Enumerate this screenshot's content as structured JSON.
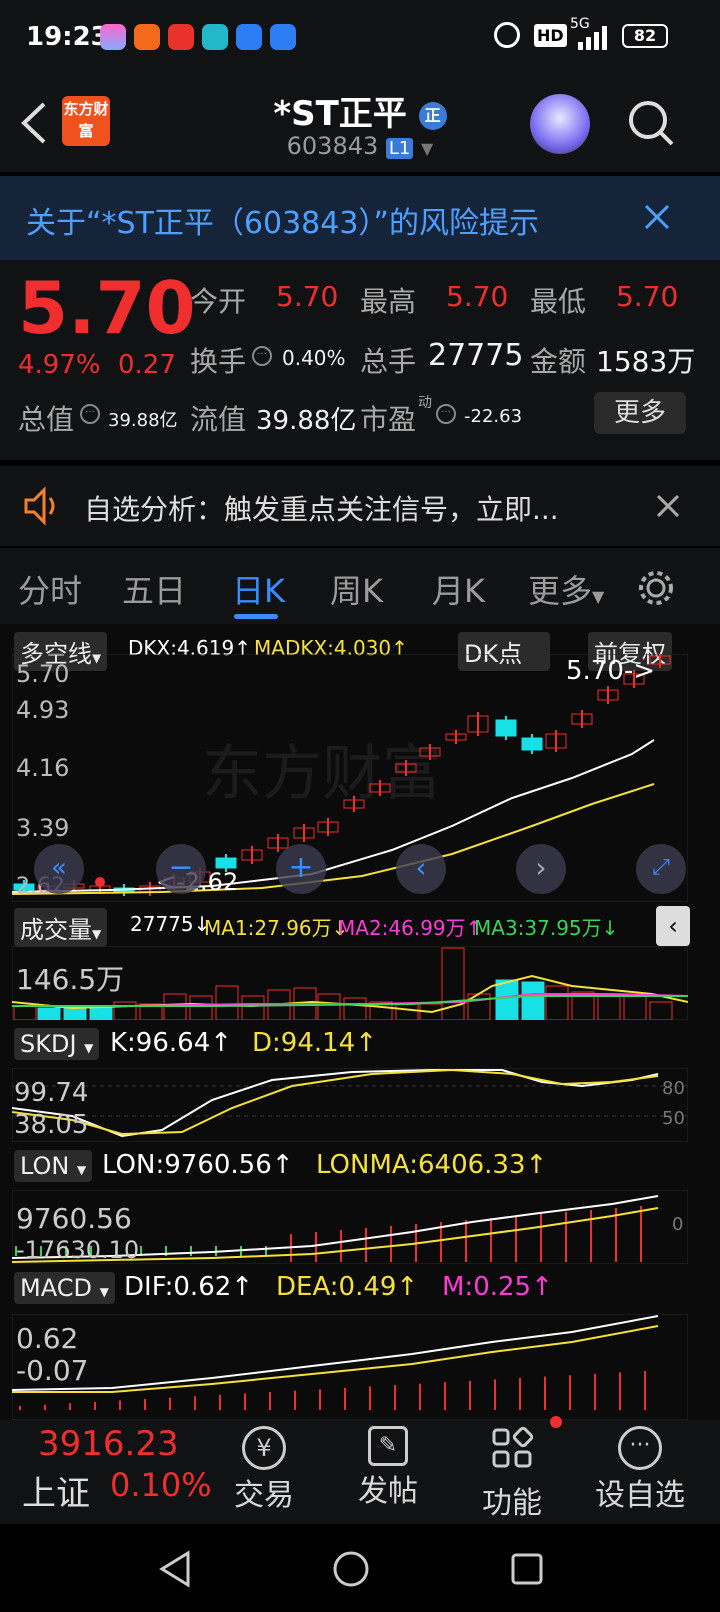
{
  "status_bar": {
    "time": "19:23",
    "network": "5G",
    "battery": "82",
    "hd": "HD"
  },
  "header": {
    "title": "*ST正平",
    "badge": "正",
    "code": "603843",
    "level": "L1",
    "logo_text": "东方财富"
  },
  "banner": {
    "text": "关于“*ST正平（603843）”的风险提示"
  },
  "quote": {
    "price": "5.70",
    "change_pct": "4.97%",
    "change": "0.27",
    "open_label": "今开",
    "open": "5.70",
    "high_label": "最高",
    "high": "5.70",
    "low_label": "最低",
    "low": "5.70",
    "turnover_label": "换手",
    "turnover": "0.40%",
    "volume_label": "总手",
    "volume": "27775",
    "amount_label": "金额",
    "amount": "1583万",
    "mcap_label": "总值",
    "mcap": "39.88亿",
    "float_label": "流值",
    "float": "39.88亿",
    "pe_label": "市盈",
    "pe_sup": "动",
    "pe": "-22.63",
    "more_button": "更多"
  },
  "notice": {
    "text": "自选分析：触发重点关注信号，立即..."
  },
  "tabs": [
    "分时",
    "五日",
    "日K",
    "周K",
    "月K",
    "更多"
  ],
  "chart": {
    "main_indicator": "多空线",
    "dkx": "DKX:4.619↑",
    "madkx": "MADKX:4.030↑",
    "dk_button": "DK点",
    "adjust_button": "前复权",
    "y_labels": [
      "5.70",
      "4.93",
      "4.16",
      "3.39",
      "2.62"
    ],
    "price_tag": "5.70->",
    "low_tag": "<-2.62",
    "watermark": "东方财富",
    "volume": {
      "name": "成交量",
      "value": "27775↓",
      "ma1": "MA1:27.96万↓",
      "ma2": "MA2:46.99万↑",
      "ma3": "MA3:37.95万↓",
      "max_label": "146.5万"
    },
    "skdj": {
      "name": "SKDJ",
      "k": "K:96.64↑",
      "d": "D:94.14↑",
      "y1": "99.74",
      "y2": "38.05",
      "r1": "80",
      "r2": "50"
    },
    "lon": {
      "name": "LON",
      "lon": "LON:9760.56↑",
      "lonma": "LONMA:6406.33↑",
      "y1": "9760.56",
      "y2": "-17630.10",
      "r1": "0"
    },
    "macd": {
      "name": "MACD",
      "dif": "DIF:0.62↑",
      "dea": "DEA:0.49↑",
      "m": "M:0.25↑",
      "y1": "0.62",
      "y2": "-0.07"
    }
  },
  "bottom": {
    "index_value": "3916.23",
    "index_name": "上证",
    "index_pct": "0.10%",
    "trade": "交易",
    "post": "发帖",
    "func": "功能",
    "fav": "设自选"
  },
  "colors": {
    "up": "#f02e2e",
    "down": "#17e0e6",
    "accent": "#3a8dff",
    "yellow": "#f5e13a",
    "magenta": "#ff3ad9",
    "green": "#3ad35a"
  }
}
